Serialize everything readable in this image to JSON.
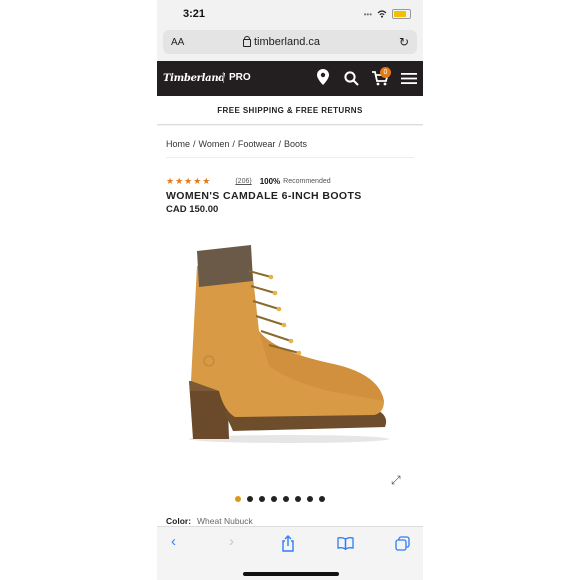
{
  "status": {
    "time": "3:21",
    "signal": "•••",
    "wifi": "wifi"
  },
  "browser": {
    "aa_label": "AA",
    "url": "timberland.ca",
    "reload_icon": "reload-icon"
  },
  "header": {
    "logo": "Timberland",
    "pro": "PRO",
    "cart_count": "0"
  },
  "promo": {
    "text": "FREE SHIPPING & FREE RETURNS"
  },
  "breadcrumb": [
    "Home",
    "/",
    "Women",
    "/",
    "Footwear",
    "/",
    "Boots"
  ],
  "product": {
    "stars": "★★★★★",
    "review_count": "(206)",
    "recommended_pct": "100%",
    "recommended_label": "Recommended",
    "title": "WOMEN'S CAMDALE 6-INCH BOOTS",
    "price": "CAD 150.00",
    "color_label": "Color:",
    "color_value": "Wheat Nubuck",
    "image_count": 8,
    "active_image": 1
  },
  "toolbar": {
    "back": "‹",
    "forward": "›"
  },
  "colors": {
    "header_bg": "#231f20",
    "accent": "#e07b1a",
    "ios_blue": "#2f7cf6"
  }
}
